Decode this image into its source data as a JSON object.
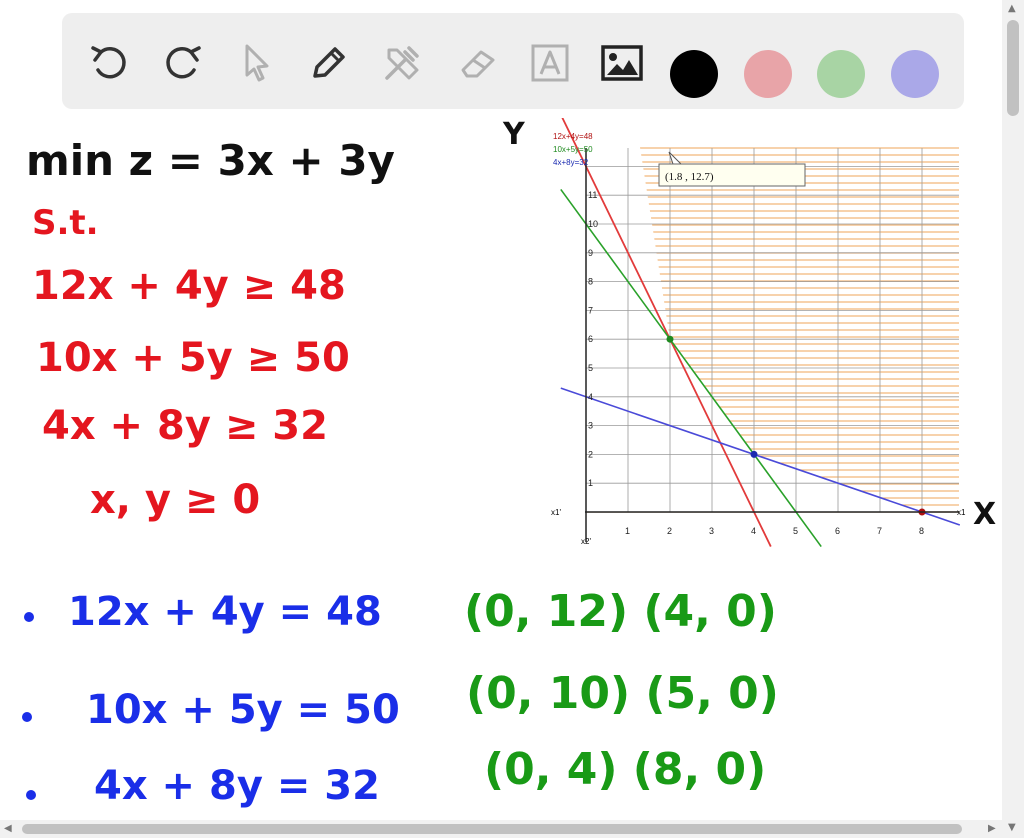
{
  "toolbar": {
    "tools": [
      {
        "icon": "undo-icon"
      },
      {
        "icon": "redo-icon"
      },
      {
        "icon": "pointer-icon"
      },
      {
        "icon": "pen-icon"
      },
      {
        "icon": "tools-icon"
      },
      {
        "icon": "eraser-icon"
      },
      {
        "icon": "text-icon"
      },
      {
        "icon": "image-icon"
      }
    ],
    "colors": [
      "#000000",
      "#e8a4a8",
      "#a8d4a4",
      "#aaa8e8"
    ]
  },
  "problem": {
    "objective": "min z = 3x + 3y",
    "st": "S.t.",
    "constraints": [
      "12x + 4y ≥ 48",
      "10x + 5y ≥ 50",
      "4x + 8y ≥ 32"
    ],
    "nonneg": "x, y ≥ 0"
  },
  "lines": [
    {
      "equation": "12x + 4y = 48",
      "points": "(0, 12) (4, 0)"
    },
    {
      "equation": "10x + 5y = 50",
      "points": "(0, 10) (5, 0)"
    },
    {
      "equation": "4x + 8y = 32",
      "points": "(0, 4) (8, 0)"
    }
  ],
  "graph": {
    "axis_y_hand": "Y",
    "axis_x_hand": "X",
    "x_axis_label": "x1",
    "x_neg_label": "x1'",
    "y_neg_label": "x2'",
    "tooltip": "(1.8 , 12.7)",
    "legend": [
      {
        "text": "12x+4y=48",
        "color": "#b01010"
      },
      {
        "text": "10x+5y=50",
        "color": "#1f8a1f"
      },
      {
        "text": "4x+8y=32",
        "color": "#1a2ab0"
      }
    ],
    "x_ticks": [
      "1",
      "2",
      "3",
      "4",
      "5",
      "6",
      "7",
      "8"
    ],
    "y_ticks": [
      "1",
      "2",
      "3",
      "4",
      "5",
      "6",
      "7",
      "8",
      "9",
      "10",
      "11"
    ],
    "points": [
      {
        "x": 2,
        "y": 6,
        "color": "#1f8a1f"
      },
      {
        "x": 4,
        "y": 2,
        "color": "#1a2ab0"
      },
      {
        "x": 8,
        "y": 0,
        "color": "#b01010"
      }
    ],
    "colors": {
      "red": "#e23b3b",
      "green": "#2aa12a",
      "blue": "#4a4ad8",
      "shade": "#f2b77a",
      "grid": "#9a9a9a"
    }
  }
}
